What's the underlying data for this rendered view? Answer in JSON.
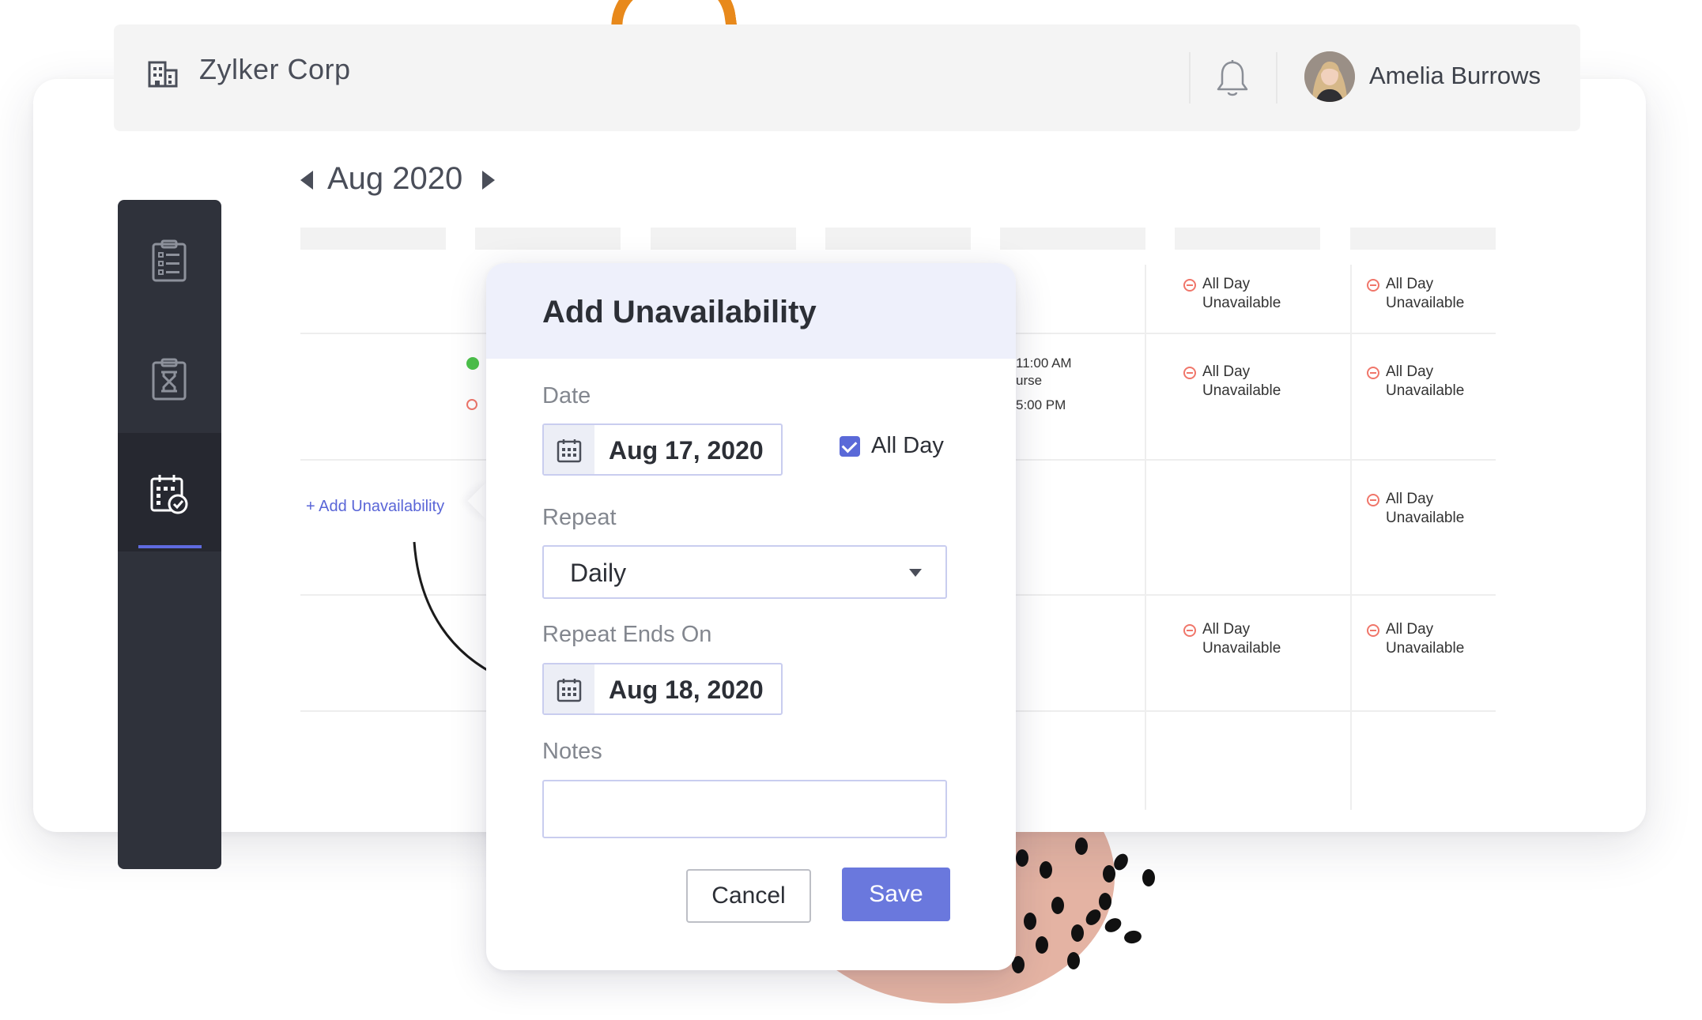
{
  "header": {
    "org_name": "Zylker Corp",
    "user_name": "Amelia Burrows"
  },
  "calendar": {
    "month_label": "Aug 2020",
    "add_unavailability_link": "+ Add Unavailability",
    "status_all_day": "All Day",
    "status_unavailable": "Unavailable",
    "time_1": "11:00 AM",
    "time_2": "urse",
    "time_3": "5:00 PM"
  },
  "modal": {
    "title": "Add Unavailability",
    "date_label": "Date",
    "date_value": "Aug 17, 2020",
    "all_day_label": "All Day",
    "all_day_checked": true,
    "repeat_label": "Repeat",
    "repeat_value": "Daily",
    "repeat_ends_label": "Repeat Ends On",
    "repeat_ends_value": "Aug 18, 2020",
    "notes_label": "Notes",
    "notes_value": "",
    "cancel_label": "Cancel",
    "save_label": "Save"
  },
  "colors": {
    "accent": "#5a69d8",
    "sidebar": "#2f323b",
    "unavailable": "#f0766a",
    "available": "#4cc24a"
  },
  "sidebar": {
    "items": [
      {
        "icon": "clipboard-list-icon"
      },
      {
        "icon": "hourglass-clipboard-icon"
      },
      {
        "icon": "calendar-check-icon",
        "active": true
      }
    ]
  }
}
